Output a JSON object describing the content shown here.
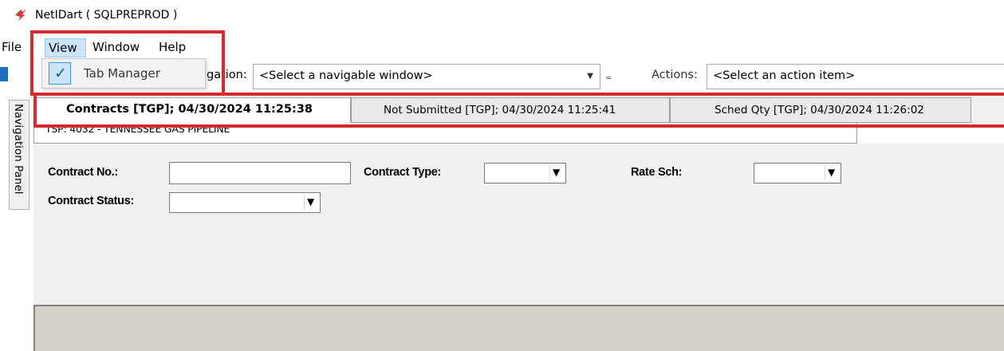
{
  "window": {
    "title": "NetIDart ( SQLPREPROD )",
    "app_icon": "lightning-bolt-icon"
  },
  "menubar": {
    "file_fragment": "File",
    "view": "View",
    "window": "Window",
    "help": "Help"
  },
  "view_menu": {
    "items": [
      {
        "label": "Tab Manager",
        "checked": true,
        "check_glyph": "✓"
      }
    ]
  },
  "toolbar": {
    "navigation_label_fragment": "gation:",
    "navigation_value": "<Select a navigable window>",
    "actions_label": "Actions:",
    "actions_value": "<Select an action item>"
  },
  "navigation_panel": {
    "label": "Navigation Panel"
  },
  "tabs": [
    {
      "label": "Contracts [TGP]; 04/30/2024 11:25:38",
      "active": true
    },
    {
      "label": "Not Submitted [TGP]; 04/30/2024 11:25:41",
      "active": false
    },
    {
      "label": "Sched Qty [TGP]; 04/30/2024 11:26:02",
      "active": false
    }
  ],
  "tsp": {
    "text": "TSP:   4032 - TENNESSEE GAS PIPELINE"
  },
  "form": {
    "contract_no_label": "Contract No.:",
    "contract_no_value": "",
    "contract_type_label": "Contract Type:",
    "contract_type_value": "",
    "rate_sch_label": "Rate Sch:",
    "rate_sch_value": "",
    "contract_status_label": "Contract Status:",
    "contract_status_value": ""
  },
  "colors": {
    "highlight": "#d42c2c",
    "menu_selected": "#cce4f7",
    "panel_bg": "#f0f0f0"
  }
}
